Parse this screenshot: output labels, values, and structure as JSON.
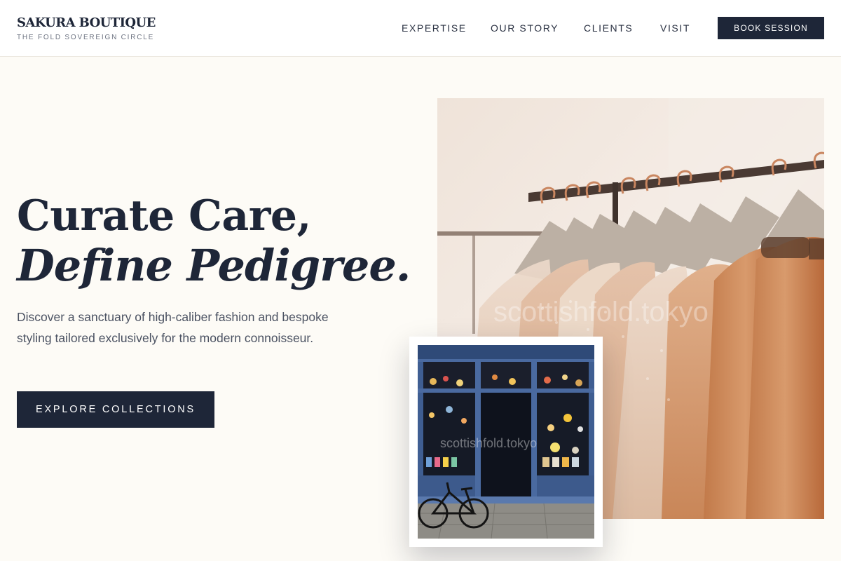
{
  "brand": {
    "name": "SAKURA BOUTIQUE",
    "tagline": "THE FOLD SOVEREIGN CIRCLE"
  },
  "nav": {
    "items": [
      {
        "label": "EXPERTISE"
      },
      {
        "label": "OUR STORY"
      },
      {
        "label": "CLIENTS"
      },
      {
        "label": "VISIT"
      }
    ],
    "cta_label": "BOOK SESSION"
  },
  "hero": {
    "headline_line1": "Curate Care,",
    "headline_line2": "Define Pedigree.",
    "description": "Discover a sanctuary of high-caliber fashion and bespoke styling tailored exclusively for the modern connoisseur.",
    "cta_label": "EXPLORE COLLECTIONS"
  },
  "images": {
    "main_watermark": "scottishfold.tokyo",
    "inset_watermark": "scottishfold.tokyo"
  },
  "colors": {
    "primary": "#1e2638",
    "background": "#fdfbf6",
    "header_bg": "#ffffff",
    "body_text": "#4b5262"
  }
}
